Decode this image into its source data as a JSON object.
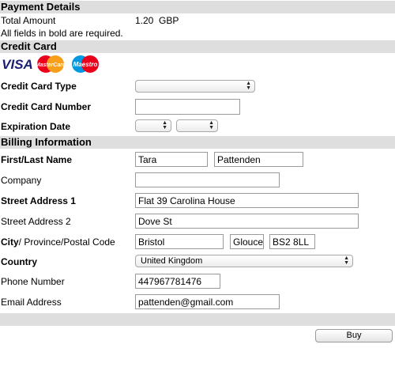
{
  "payment": {
    "header": "Payment Details",
    "total_label": "Total Amount",
    "total_value": "1.20",
    "currency": "GBP",
    "required_note": "All fields in bold are required."
  },
  "credit_card": {
    "header": "Credit Card",
    "logos": {
      "visa": "VISA",
      "mastercard": "MasterCard",
      "maestro": "Maestro"
    },
    "type_label": "Credit Card Type",
    "type_value": "",
    "number_label": "Credit Card Number",
    "number_value": "",
    "expiry_label": "Expiration Date",
    "expiry_month": "",
    "expiry_year": ""
  },
  "billing": {
    "header": "Billing Information",
    "name_label": "First/Last Name",
    "first_name": "Tara",
    "last_name": "Pattenden",
    "company_label": "Company",
    "company_value": "",
    "street1_label": "Street Address 1",
    "street1_value": "Flat 39 Carolina House",
    "street2_label": "Street Address 2",
    "street2_value": "Dove St",
    "city_label_bold": "City",
    "city_label_rest": "/ Province/Postal Code",
    "city_value": "Bristol",
    "province_value": "Glouce",
    "postal_value": "BS2 8LL",
    "country_label": "Country",
    "country_value": "United Kingdom",
    "phone_label": "Phone Number",
    "phone_value": "447967781476",
    "email_label": "Email Address",
    "email_value": "pattenden@gmail.com"
  },
  "actions": {
    "buy_label": "Buy"
  },
  "colors": {
    "section_bar": "#dedede",
    "visa_blue": "#1a1f71",
    "mc_red": "#eb001b",
    "mc_orange": "#f79e1b",
    "maestro_blue": "#0099df"
  }
}
